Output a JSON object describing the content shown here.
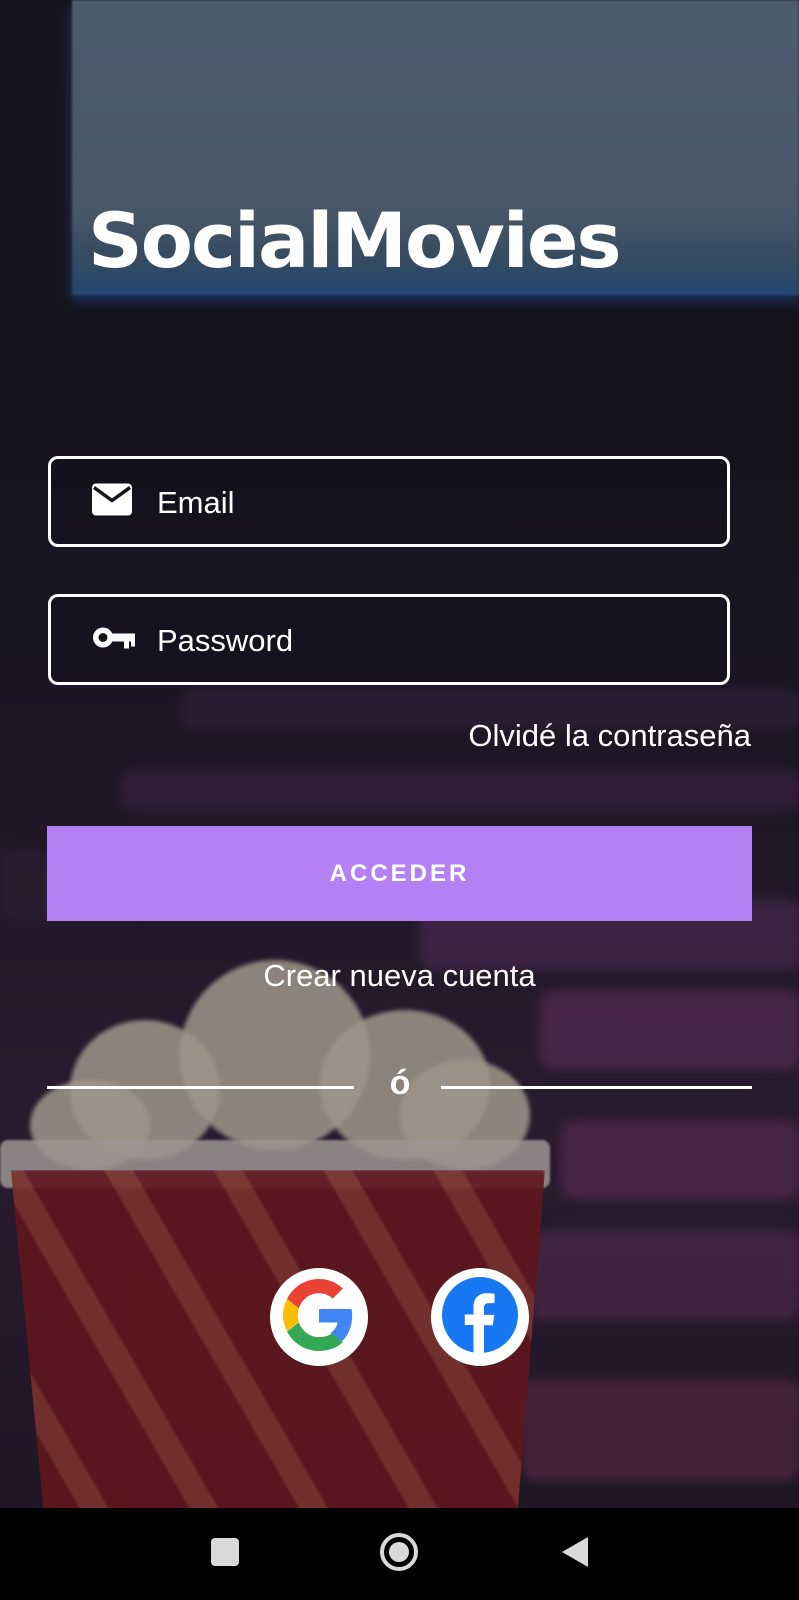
{
  "app": {
    "title": "SocialMovies"
  },
  "login": {
    "email_placeholder": "Email",
    "password_placeholder": "Password",
    "forgot_label": "Olvidé la contraseña",
    "submit_label": "ACCEDER",
    "create_account_label": "Crear nueva cuenta",
    "or_label": "ó"
  },
  "social": [
    {
      "icon": "google-icon"
    },
    {
      "icon": "facebook-icon"
    }
  ],
  "colors": {
    "accent": "#b481f5",
    "facebook": "#1877f2",
    "field_border": "#ffffff"
  },
  "navbar": {
    "icons": [
      "recent-apps-icon",
      "home-icon",
      "back-icon"
    ]
  }
}
